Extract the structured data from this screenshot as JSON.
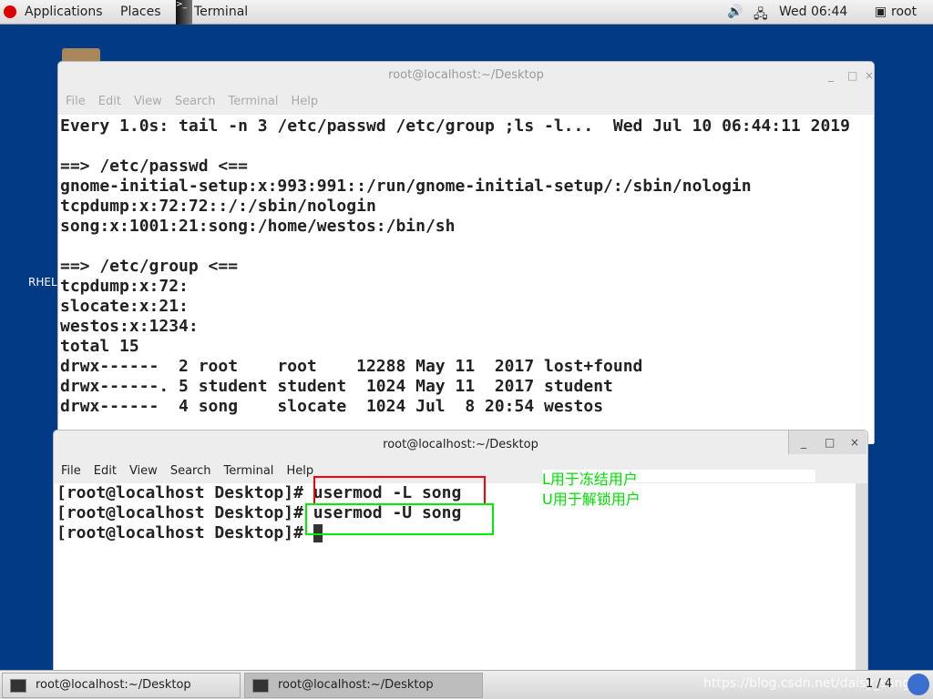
{
  "topbar": {
    "applications": "Applications",
    "places": "Places",
    "terminal": "Terminal",
    "clock": "Wed 06:44",
    "user": "root"
  },
  "desktop": {
    "label": "RHEL"
  },
  "window1": {
    "title": "root@localhost:~/Desktop",
    "menu": [
      "File",
      "Edit",
      "View",
      "Search",
      "Terminal",
      "Help"
    ],
    "lines": [
      "Every 1.0s: tail -n 3 /etc/passwd /etc/group ;ls -l...  Wed Jul 10 06:44:11 2019",
      "",
      "==> /etc/passwd <==",
      "gnome-initial-setup:x:993:991::/run/gnome-initial-setup/:/sbin/nologin",
      "tcpdump:x:72:72::/:/sbin/nologin",
      "song:x:1001:21:song:/home/westos:/bin/sh",
      "",
      "==> /etc/group <==",
      "tcpdump:x:72:",
      "slocate:x:21:",
      "westos:x:1234:",
      "total 15",
      "drwx------  2 root    root    12288 May 11  2017 lost+found",
      "drwx------. 5 student student  1024 May 11  2017 student",
      "drwx------  4 song    slocate  1024 Jul  8 20:54 westos"
    ]
  },
  "window2": {
    "title": "root@localhost:~/Desktop",
    "menu": [
      "File",
      "Edit",
      "View",
      "Search",
      "Terminal",
      "Help"
    ],
    "prompt": "[root@localhost Desktop]# ",
    "commands": [
      "usermod -L song",
      "usermod -U song",
      ""
    ]
  },
  "annotation": {
    "lines": [
      "L用于冻结用户",
      "U用于解锁用户"
    ],
    "color": "#00e000",
    "box1_color": "#ff0000",
    "box2_color": "#00e000"
  },
  "taskbar": {
    "tasks": [
      "root@localhost:~/Desktop",
      "root@localhost:~/Desktop"
    ],
    "pager": "1 / 4",
    "watermark": "https://blog.csdn.net/daisy_sangy"
  }
}
